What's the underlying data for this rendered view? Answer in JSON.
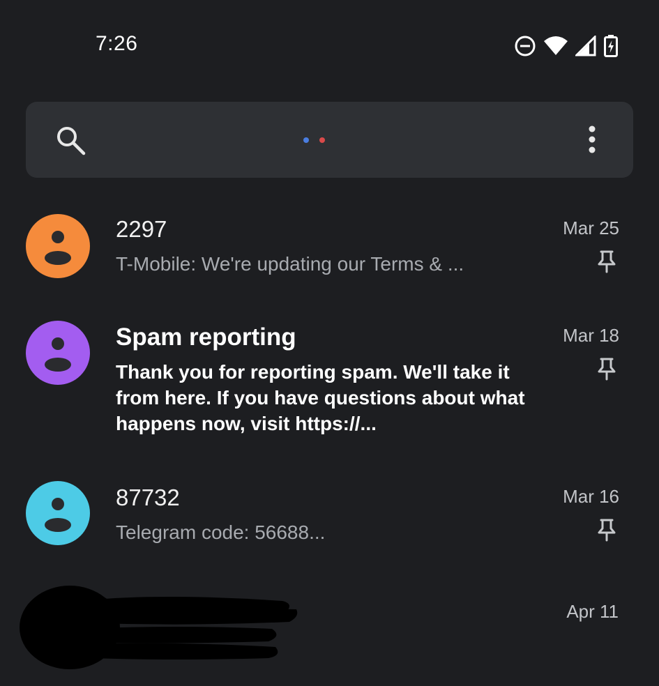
{
  "status_bar": {
    "time": "7:26",
    "icons": [
      "do-not-disturb-icon",
      "wifi-icon",
      "signal-icon",
      "battery-charging-icon"
    ]
  },
  "search_bar": {
    "icon": "search-icon",
    "menu_icon": "more-vert-icon",
    "dot_colors": [
      "#4a7de0",
      "#d94a4a"
    ]
  },
  "conversations": [
    {
      "name": "2297",
      "snippet": "T-Mobile: We're updating our Terms & ...",
      "date": "Mar 25",
      "avatar_color": "#f58b3c",
      "unread": false,
      "pinned": true
    },
    {
      "name": "Spam reporting",
      "snippet": "Thank you for reporting spam. We'll take it from here. If you have questions about what happens now, visit https://...",
      "date": "Mar 18",
      "avatar_color": "#a35df0",
      "unread": true,
      "pinned": true
    },
    {
      "name": "87732",
      "snippet": "Telegram code: 56688...",
      "date": "Mar 16",
      "avatar_color": "#4dcbe6",
      "unread": false,
      "pinned": true
    },
    {
      "name": "",
      "snippet": "",
      "date": "Apr 11",
      "avatar_color": "#000000",
      "unread": false,
      "pinned": false
    }
  ]
}
